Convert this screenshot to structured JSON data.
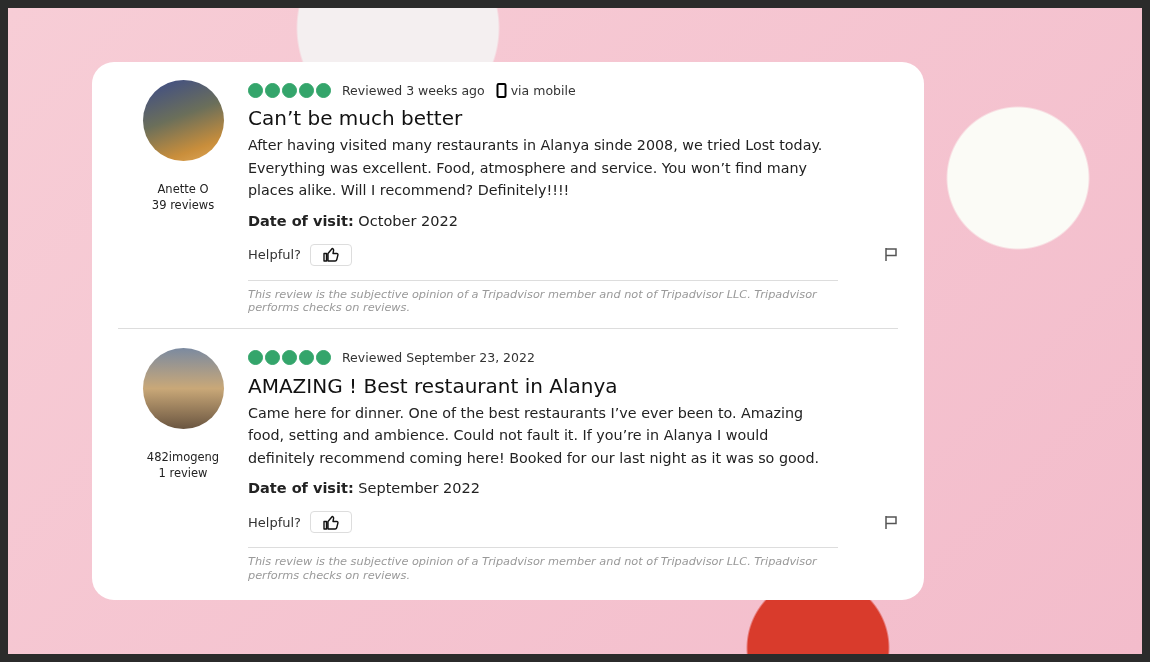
{
  "reviews": [
    {
      "author": "Anette O",
      "contributions": "39 reviews",
      "stars": 5,
      "reviewed": "Reviewed 3 weeks ago",
      "device": "via mobile",
      "title": "Can’t be much better",
      "body": "After having visited many restaurants in Alanya sinde 2008, we tried Lost today. Everything was excellent. Food, atmosphere and service. You won’t find many places alike. Will I recommend? Definitely!!!!",
      "visit": "**Date of visit:** October 2022",
      "helpful": "Helpful?",
      "disclaimer": "This review is the subjective opinion of a Tripadvisor member and not of Tripadvisor LLC. Tripadvisor performs checks on reviews."
    },
    {
      "author": "482imogeng",
      "contributions": "1 review",
      "stars": 5,
      "reviewed": "Reviewed September 23, 2022",
      "title": "AMAZING ! Best restaurant in Alanya",
      "body": "Came here for dinner. One of the best restaurants I’ve ever been to. Amazing food, setting and ambience. Could not fault it. If you’re in Alanya I would definitely recommend coming here! Booked for our last night as it was so good.",
      "visit": "**Date of visit:** September 2022",
      "helpful": "Helpful?",
      "disclaimer": "This review is the subjective opinion of a Tripadvisor member and not of Tripadvisor LLC. Tripadvisor performs checks on reviews."
    }
  ]
}
